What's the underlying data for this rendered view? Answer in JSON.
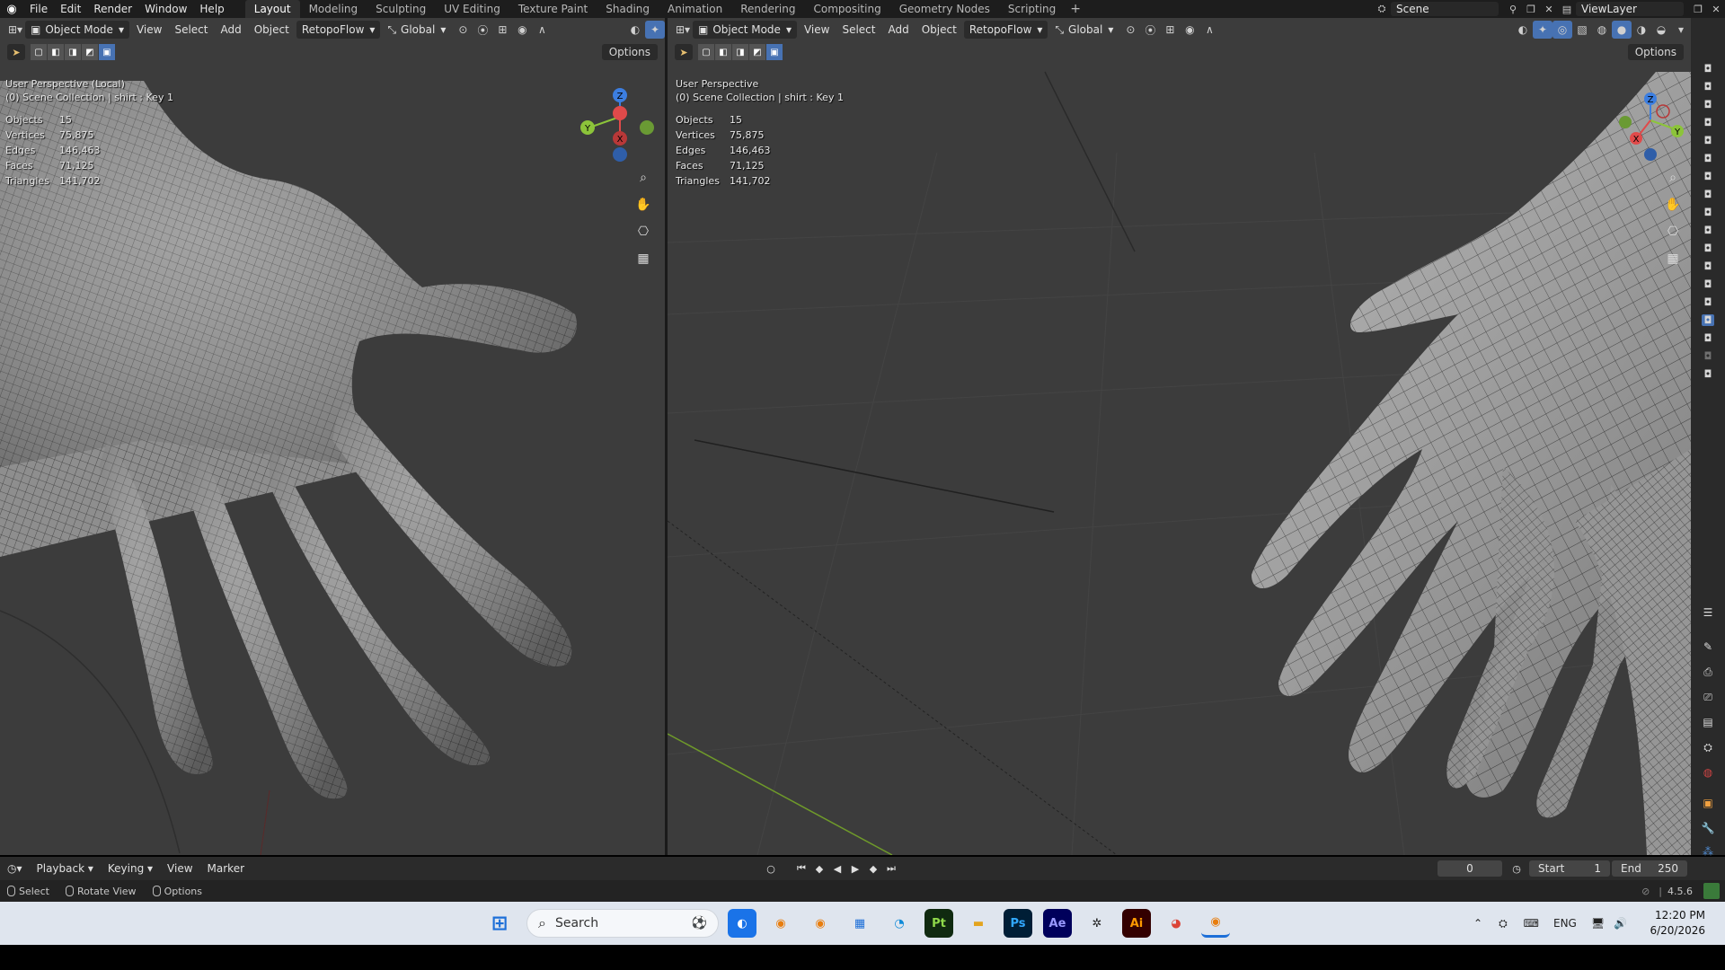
{
  "topbar": {
    "menus": [
      "File",
      "Edit",
      "Render",
      "Window",
      "Help"
    ],
    "workspaces": [
      "Layout",
      "Modeling",
      "Sculpting",
      "UV Editing",
      "Texture Paint",
      "Shading",
      "Animation",
      "Rendering",
      "Compositing",
      "Geometry Nodes",
      "Scripting"
    ],
    "active_workspace": "Layout",
    "add_tab": "+",
    "scene_name": "Scene",
    "view_layer": "ViewLayer"
  },
  "left_viewport": {
    "header": {
      "mode": "Object Mode",
      "menus": [
        "View",
        "Select",
        "Add",
        "Object"
      ],
      "addon_menu": "RetopoFlow",
      "orientation": "Global",
      "options": "Options"
    },
    "view_name": "User Perspective (Local)",
    "collection": "(0) Scene Collection | shirt : Key 1",
    "stats": [
      {
        "key": "Objects",
        "value": "15"
      },
      {
        "key": "Vertices",
        "value": "75,875"
      },
      {
        "key": "Edges",
        "value": "146,463"
      },
      {
        "key": "Faces",
        "value": "71,125"
      },
      {
        "key": "Triangles",
        "value": "141,702"
      }
    ]
  },
  "right_viewport": {
    "header": {
      "mode": "Object Mode",
      "menus": [
        "View",
        "Select",
        "Add",
        "Object"
      ],
      "addon_menu": "RetopoFlow",
      "orientation": "Global",
      "options": "Options"
    },
    "view_name": "User Perspective",
    "collection": "(0) Scene Collection | shirt : Key 1",
    "stats": [
      {
        "key": "Objects",
        "value": "15"
      },
      {
        "key": "Vertices",
        "value": "75,875"
      },
      {
        "key": "Edges",
        "value": "146,463"
      },
      {
        "key": "Faces",
        "value": "71,125"
      },
      {
        "key": "Triangles",
        "value": "141,702"
      }
    ]
  },
  "gizmo_labels": {
    "x": "X",
    "y": "Y",
    "z": "Z"
  },
  "timeline": {
    "menus": [
      "Playback",
      "Keying",
      "View",
      "Marker"
    ],
    "current_frame": "0",
    "start_label": "Start",
    "start_value": "1",
    "end_label": "End",
    "end_value": "250"
  },
  "statusbar": {
    "items": [
      "Select",
      "Rotate View",
      "Options"
    ],
    "version": "4.5.6"
  },
  "taskbar": {
    "search_placeholder": "Search",
    "language": "ENG",
    "time": "12:20 PM",
    "date": "6/20/2026",
    "app_labels": {
      "pt": "Pt",
      "ps": "Ps",
      "ae": "Ae",
      "ai": "Ai"
    }
  },
  "colors": {
    "accent": "#4772b3",
    "axis_x": "#e04a4a",
    "axis_y": "#8cc43a",
    "axis_z": "#3c7ee0",
    "viewport_bg": "#3c3c3c"
  }
}
